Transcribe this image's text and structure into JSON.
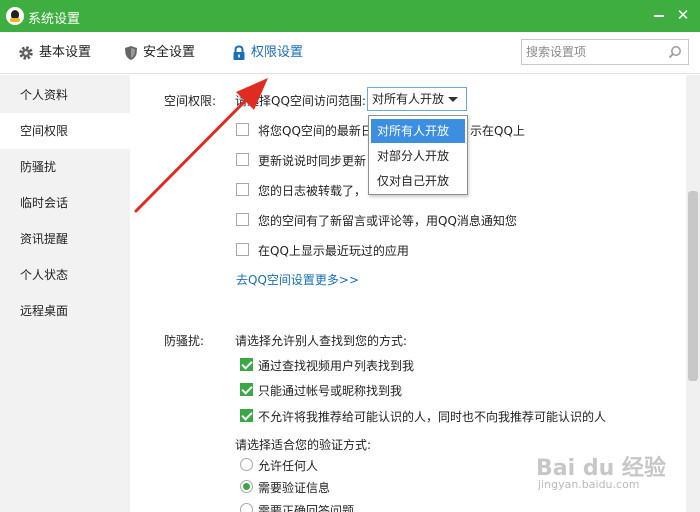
{
  "window": {
    "title": "系统设置",
    "close_glyph": "✕"
  },
  "toolbar": {
    "tabs": [
      {
        "label": "基本设置",
        "icon": "gear-icon"
      },
      {
        "label": "安全设置",
        "icon": "shield-icon"
      },
      {
        "label": "权限设置",
        "icon": "lock-icon",
        "active": true
      }
    ],
    "search_placeholder": "搜索设置项"
  },
  "sidebar": {
    "items": [
      {
        "label": "个人资料"
      },
      {
        "label": "空间权限",
        "active": true
      },
      {
        "label": "防骚扰"
      },
      {
        "label": "临时会话"
      },
      {
        "label": "资讯提醒"
      },
      {
        "label": "个人状态"
      },
      {
        "label": "远程桌面"
      }
    ]
  },
  "space": {
    "heading": "空间权限:",
    "scope_prompt": "请选择QQ空间访问范围:",
    "scope_value": "对所有人开放",
    "scope_options": [
      "对所有人开放",
      "对部分人开放",
      "仅对自己开放"
    ],
    "options": [
      {
        "label": "将您QQ空间的最新日",
        "tail": "示在QQ上",
        "checked": false
      },
      {
        "label": "更新说说时同步更新",
        "checked": false
      },
      {
        "label": "您的日志被转载了，",
        "checked": false
      },
      {
        "label": "您的空间有了新留言或评论等，用QQ消息通知您",
        "checked": false
      },
      {
        "label": "在QQ上显示最近玩过的应用",
        "checked": false
      }
    ],
    "more_link": "去QQ空间设置更多>>"
  },
  "harass": {
    "heading": "防骚扰:",
    "find_prompt": "请选择允许别人查找到您的方式:",
    "find_options": [
      {
        "label": "通过查找视频用户列表找到我",
        "checked": true
      },
      {
        "label": "只能通过帐号或昵称找到我",
        "checked": true
      },
      {
        "label": "不允许将我推荐给可能认识的人，同时也不向我推荐可能认识的人",
        "checked": true
      }
    ],
    "verify_prompt": "请选择适合您的验证方式:",
    "verify_options": [
      {
        "label": "允许任何人",
        "checked": false
      },
      {
        "label": "需要验证信息",
        "checked": true
      },
      {
        "label": "需要正确回答问题",
        "checked": false
      }
    ]
  },
  "watermark": {
    "line1": "Bai du 经验",
    "line2": "jingyan.baidu.com"
  },
  "colors": {
    "title_bar": "#3dae3f",
    "accent": "#1a6fb6",
    "check": "#3aa844",
    "selection": "#3c8ee0",
    "arrow": "#e02b20"
  }
}
